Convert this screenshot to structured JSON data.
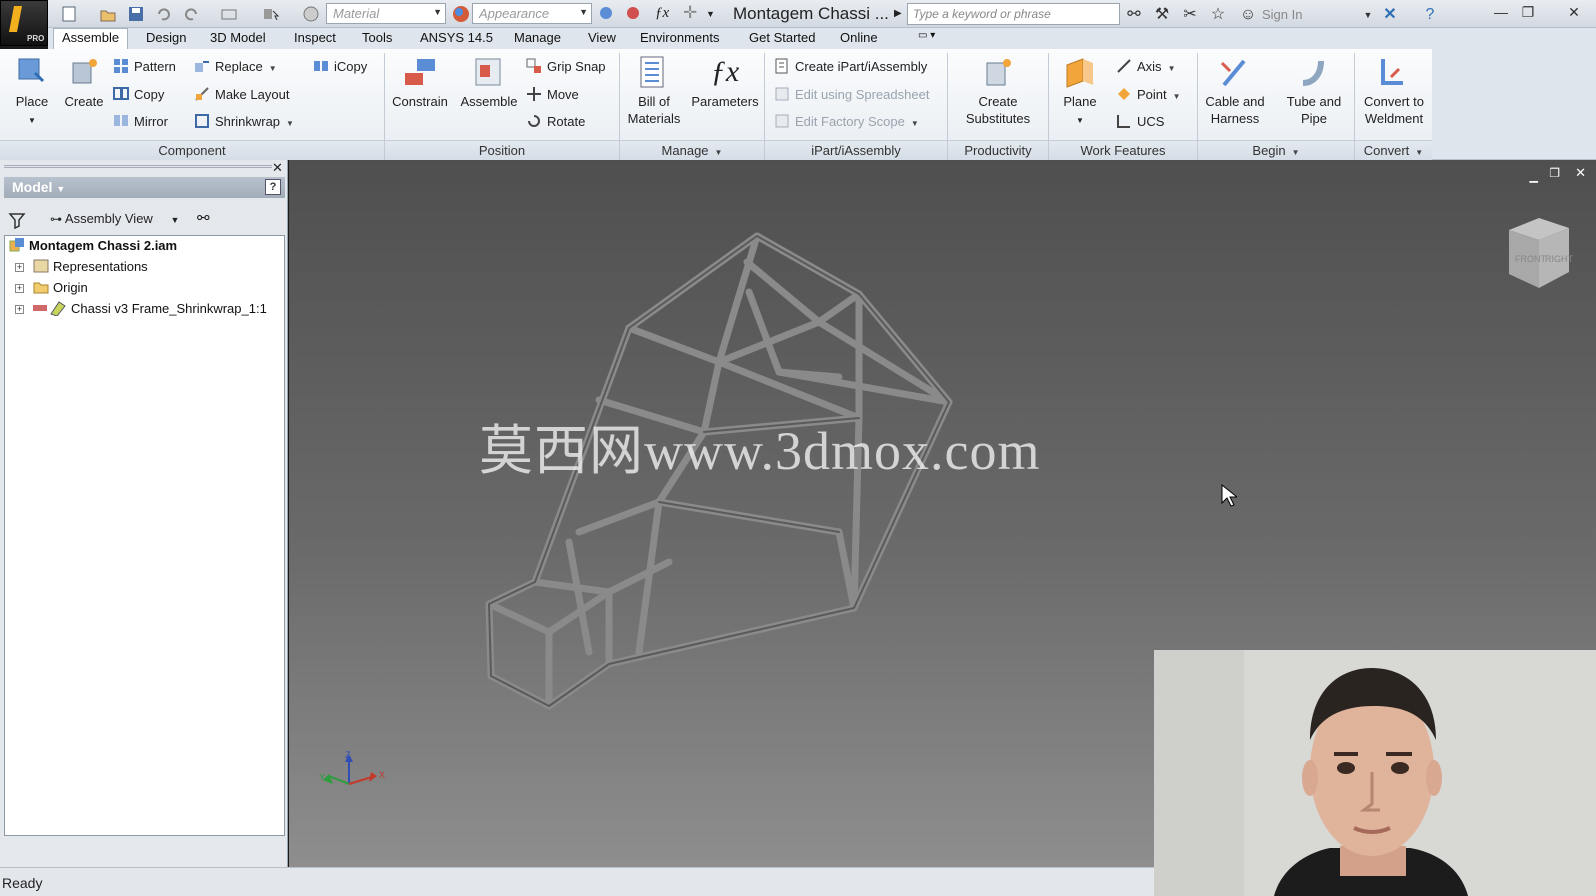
{
  "titlebar": {
    "material_placeholder": "Material",
    "appearance_placeholder": "Appearance",
    "document_title": "Montagem Chassi ...",
    "search_placeholder": "Type a keyword or phrase",
    "sign_in": "Sign In",
    "logo_badge": "PRO"
  },
  "tabs": [
    "Assemble",
    "Design",
    "3D Model",
    "Inspect",
    "Tools",
    "ANSYS 14.5",
    "Manage",
    "View",
    "Environments",
    "Get Started",
    "Online"
  ],
  "ribbon": {
    "component": {
      "label": "Component",
      "place": "Place",
      "create": "Create",
      "pattern": "Pattern",
      "copy": "Copy",
      "mirror": "Mirror",
      "replace": "Replace",
      "make_layout": "Make Layout",
      "shrinkwrap": "Shrinkwrap",
      "icopy": "iCopy"
    },
    "position": {
      "label": "Position",
      "constrain": "Constrain",
      "assemble": "Assemble",
      "grip_snap": "Grip Snap",
      "move": "Move",
      "rotate": "Rotate"
    },
    "manage": {
      "label": "Manage",
      "bom_line1": "Bill of",
      "bom_line2": "Materials",
      "parameters": "Parameters"
    },
    "ipart": {
      "label": "iPart/iAssembly",
      "create": "Create iPart/iAssembly",
      "edit_spreadsheet": "Edit using Spreadsheet",
      "edit_factory": "Edit Factory Scope"
    },
    "productivity": {
      "label": "Productivity",
      "line1": "Create",
      "line2": "Substitutes"
    },
    "work_features": {
      "label": "Work Features",
      "plane": "Plane",
      "axis": "Axis",
      "point": "Point",
      "ucs": "UCS"
    },
    "begin": {
      "label": "Begin",
      "cable_line1": "Cable and",
      "cable_line2": "Harness",
      "tube_line1": "Tube and",
      "tube_line2": "Pipe"
    },
    "convert": {
      "label": "Convert",
      "line1": "Convert to",
      "line2": "Weldment"
    }
  },
  "browser": {
    "title": "Model",
    "view_selector": "Assembly View",
    "tree": [
      {
        "label": "Montagem Chassi 2.iam"
      },
      {
        "label": "Representations"
      },
      {
        "label": "Origin"
      },
      {
        "label": "Chassi v3 Frame_Shrinkwrap_1:1"
      }
    ]
  },
  "viewport": {
    "watermark": "莫西网www.3dmox.com",
    "viewcube_faces": [
      "FRONT",
      "RIGHT"
    ],
    "axis_labels": [
      "Z",
      "Y",
      "X"
    ]
  },
  "status": "Ready",
  "colors": {
    "accent": "#2f6eb5",
    "viewport_top": "#4f4f4f",
    "viewport_bottom": "#8e8e8e"
  }
}
